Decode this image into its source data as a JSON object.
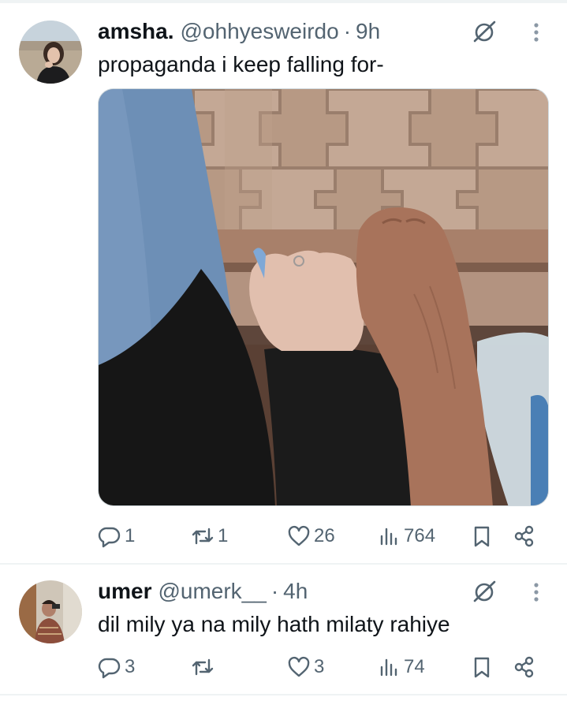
{
  "tweets": [
    {
      "name": "amsha.",
      "handle": "@ohhyesweirdo",
      "separator": "·",
      "time": "9h",
      "text": "propaganda i keep falling for-",
      "has_media": true,
      "replies": "1",
      "reposts": "1",
      "likes": "26",
      "views": "764"
    },
    {
      "name": "umer",
      "handle": "@umerk__",
      "separator": "·",
      "time": "4h",
      "text": "dil mily ya na mily hath milaty rahiye",
      "has_media": false,
      "replies": "3",
      "reposts": "",
      "likes": "3",
      "views": "74"
    }
  ],
  "colors": {
    "text": "#0f1419",
    "secondary": "#536471",
    "divider": "#eff3f4"
  },
  "icons": [
    "grok-icon",
    "more-icon",
    "reply-icon",
    "repost-icon",
    "like-icon",
    "views-icon",
    "bookmark-icon",
    "share-icon"
  ]
}
